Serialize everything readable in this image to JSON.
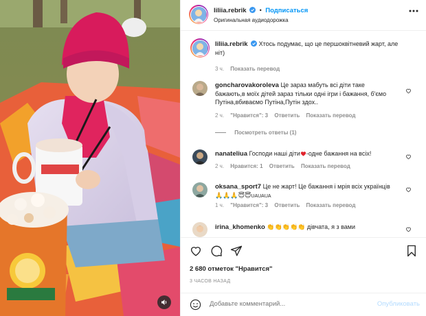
{
  "post": {
    "username": "liliia.rebrik",
    "follow_label": "Подписаться",
    "separator": "•",
    "audio": "Оригинальная аудиодорожка"
  },
  "caption": {
    "username": "liliia.rebrik",
    "text": "Хтось подумає, що це першоквітневий жарт, але ніт)",
    "time": "3 ч.",
    "translate": "Показать перевод"
  },
  "comments": [
    {
      "username": "goncharovakoroleva",
      "text": "Це зараз мабуть всі діти таке бажають,в моїх дітей зараз тільки одні ігри і бажання, б'ємо Путіна,вбиваємо Путіна,Путін здох..",
      "time": "2 ч.",
      "likes": "\"Нравится\": 3",
      "reply": "Ответить",
      "translate": "Показать перевод",
      "replies": "Посмотреть ответы (1)"
    },
    {
      "username": "nanateliua",
      "text_before": "Господи наші діти",
      "text_after": "-одне бажання на всіх!",
      "time": "2 ч.",
      "likes": "Нравится: 1",
      "reply": "Ответить",
      "translate": "Показать перевод"
    },
    {
      "username": "oksana_sport7",
      "text": "Це не жарт! Це бажання і мрія всіх українців",
      "text_emoji": "🙏🙏🙏😇😇",
      "text_tail": "UAUAUA",
      "time": "1 ч.",
      "likes": "\"Нравится\": 3",
      "reply": "Ответить",
      "translate": "Показать перевод"
    },
    {
      "username": "irina_khomenko",
      "text_emoji": "👏👏👏👏👏",
      "text": "дівчата, я з вами"
    }
  ],
  "stats": {
    "likes": "2 680 отметок \"Нравится\"",
    "time": "3 ЧАСОВ НАЗАД"
  },
  "add_comment": {
    "placeholder": "Добавьте комментарий...",
    "post_label": "Опубликовать"
  },
  "icons": [
    "audio-icon",
    "verified-icon",
    "more-icon",
    "heart-icon",
    "comment-icon",
    "share-icon",
    "bookmark-icon",
    "emoji-icon"
  ],
  "colors": {
    "link": "#0095f6",
    "muted": "#8e8e8e",
    "verified": "#3897f0",
    "post_disabled": "#b3dbff"
  }
}
